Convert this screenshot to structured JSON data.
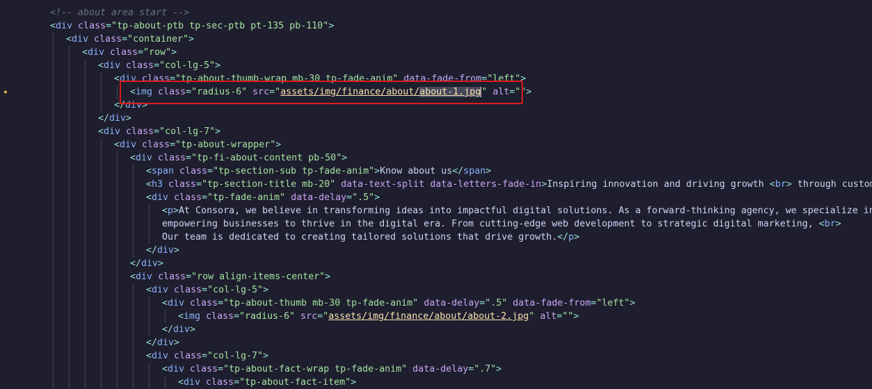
{
  "lines": [
    [
      [
        "cmt",
        "<!-- about area start -->"
      ]
    ],
    [
      [
        "brk",
        "<"
      ],
      [
        "tag",
        "div"
      ],
      [
        "attr",
        " class"
      ],
      [
        "eq",
        "="
      ],
      [
        "str",
        "\"tp-about-ptb tp-sec-ptb pt-135 pb-110\""
      ],
      [
        "brk",
        ">"
      ]
    ],
    [
      [
        "brk",
        "<"
      ],
      [
        "tag",
        "div"
      ],
      [
        "attr",
        " class"
      ],
      [
        "eq",
        "="
      ],
      [
        "str",
        "\"container\""
      ],
      [
        "brk",
        ">"
      ]
    ],
    [
      [
        "brk",
        "<"
      ],
      [
        "tag",
        "div"
      ],
      [
        "attr",
        " class"
      ],
      [
        "eq",
        "="
      ],
      [
        "str",
        "\"row\""
      ],
      [
        "brk",
        ">"
      ]
    ],
    [
      [
        "brk",
        "<"
      ],
      [
        "tag",
        "div"
      ],
      [
        "attr",
        " class"
      ],
      [
        "eq",
        "="
      ],
      [
        "str",
        "\"col-lg-5\""
      ],
      [
        "brk",
        ">"
      ]
    ],
    [
      [
        "brk",
        "<"
      ],
      [
        "tag",
        "div"
      ],
      [
        "attr",
        " class"
      ],
      [
        "eq",
        "="
      ],
      [
        "str",
        "\"tp-about-thumb-wrap mb-30 tp-fade-anim\""
      ],
      [
        "attr",
        " data-fade-from"
      ],
      [
        "eq",
        "="
      ],
      [
        "str",
        "\"left\""
      ],
      [
        "brk",
        ">"
      ]
    ],
    [
      [
        "brk",
        "<"
      ],
      [
        "tag",
        "img"
      ],
      [
        "attr",
        " class"
      ],
      [
        "eq",
        "="
      ],
      [
        "str",
        "\"radius-6\""
      ],
      [
        "attr",
        " src"
      ],
      [
        "eq",
        "="
      ],
      [
        "str",
        "\""
      ],
      [
        "link",
        "assets/img/finance/about/"
      ],
      [
        "linksel",
        "about-1.jpg"
      ],
      [
        "cursor",
        ""
      ],
      [
        "str",
        "\""
      ],
      [
        "attr",
        " alt"
      ],
      [
        "eq",
        "="
      ],
      [
        "str",
        "\"\""
      ],
      [
        "brk",
        ">"
      ]
    ],
    [
      [
        "brk",
        "</"
      ],
      [
        "tag",
        "div"
      ],
      [
        "brk",
        ">"
      ]
    ],
    [
      [
        "brk",
        "</"
      ],
      [
        "tag",
        "div"
      ],
      [
        "brk",
        ">"
      ]
    ],
    [
      [
        "brk",
        "<"
      ],
      [
        "tag",
        "div"
      ],
      [
        "attr",
        " class"
      ],
      [
        "eq",
        "="
      ],
      [
        "str",
        "\"col-lg-7\""
      ],
      [
        "brk",
        ">"
      ]
    ],
    [
      [
        "brk",
        "<"
      ],
      [
        "tag",
        "div"
      ],
      [
        "attr",
        " class"
      ],
      [
        "eq",
        "="
      ],
      [
        "str",
        "\"tp-about-wrapper\""
      ],
      [
        "brk",
        ">"
      ]
    ],
    [
      [
        "brk",
        "<"
      ],
      [
        "tag",
        "div"
      ],
      [
        "attr",
        " class"
      ],
      [
        "eq",
        "="
      ],
      [
        "str",
        "\"tp-fi-about-content pb-50\""
      ],
      [
        "brk",
        ">"
      ]
    ],
    [
      [
        "brk",
        "<"
      ],
      [
        "tag",
        "span"
      ],
      [
        "attr",
        " class"
      ],
      [
        "eq",
        "="
      ],
      [
        "str",
        "\"tp-section-sub tp-fade-anim\""
      ],
      [
        "brk",
        ">"
      ],
      [
        "txt",
        "Know about us"
      ],
      [
        "brk",
        "</"
      ],
      [
        "tag",
        "span"
      ],
      [
        "brk",
        ">"
      ]
    ],
    [
      [
        "brk",
        "<"
      ],
      [
        "tag",
        "h3"
      ],
      [
        "attr",
        " class"
      ],
      [
        "eq",
        "="
      ],
      [
        "str",
        "\"tp-section-title mb-20\""
      ],
      [
        "attr",
        " data-text-split data-letters-fade-in"
      ],
      [
        "brk",
        ">"
      ],
      [
        "txt",
        "Inspiring innovation and driving growth "
      ],
      [
        "brk",
        "<"
      ],
      [
        "tag",
        "br"
      ],
      [
        "brk",
        ">"
      ],
      [
        "txt",
        " through customized"
      ]
    ],
    [
      [
        "brk",
        "<"
      ],
      [
        "tag",
        "div"
      ],
      [
        "attr",
        " class"
      ],
      [
        "eq",
        "="
      ],
      [
        "str",
        "\"tp-fade-anim\""
      ],
      [
        "attr",
        " data-delay"
      ],
      [
        "eq",
        "="
      ],
      [
        "str",
        "\".5\""
      ],
      [
        "brk",
        ">"
      ]
    ],
    [
      [
        "brk",
        "<"
      ],
      [
        "tag",
        "p"
      ],
      [
        "brk",
        ">"
      ],
      [
        "txt",
        "At Consora, we believe in transforming ideas into impactful digital solutions. As a forward-thinking agency, we specialize in "
      ],
      [
        "brk",
        "<"
      ],
      [
        "tag",
        "br"
      ],
      [
        "brk",
        ">"
      ]
    ],
    [
      [
        "txt",
        "empowering businesses to thrive in the digital era. From cutting-edge web development to strategic digital marketing, "
      ],
      [
        "brk",
        "<"
      ],
      [
        "tag",
        "br"
      ],
      [
        "brk",
        ">"
      ]
    ],
    [
      [
        "txt",
        "Our team is dedicated to creating tailored solutions that drive growth."
      ],
      [
        "brk",
        "</"
      ],
      [
        "tag",
        "p"
      ],
      [
        "brk",
        ">"
      ]
    ],
    [
      [
        "brk",
        "</"
      ],
      [
        "tag",
        "div"
      ],
      [
        "brk",
        ">"
      ]
    ],
    [
      [
        "brk",
        "</"
      ],
      [
        "tag",
        "div"
      ],
      [
        "brk",
        ">"
      ]
    ],
    [
      [
        "brk",
        "<"
      ],
      [
        "tag",
        "div"
      ],
      [
        "attr",
        " class"
      ],
      [
        "eq",
        "="
      ],
      [
        "str",
        "\"row align-items-center\""
      ],
      [
        "brk",
        ">"
      ]
    ],
    [
      [
        "brk",
        "<"
      ],
      [
        "tag",
        "div"
      ],
      [
        "attr",
        " class"
      ],
      [
        "eq",
        "="
      ],
      [
        "str",
        "\"col-lg-5\""
      ],
      [
        "brk",
        ">"
      ]
    ],
    [
      [
        "brk",
        "<"
      ],
      [
        "tag",
        "div"
      ],
      [
        "attr",
        " class"
      ],
      [
        "eq",
        "="
      ],
      [
        "str",
        "\"tp-about-thumb mb-30 tp-fade-anim\""
      ],
      [
        "attr",
        " data-delay"
      ],
      [
        "eq",
        "="
      ],
      [
        "str",
        "\".5\""
      ],
      [
        "attr",
        " data-fade-from"
      ],
      [
        "eq",
        "="
      ],
      [
        "str",
        "\"left\""
      ],
      [
        "brk",
        ">"
      ]
    ],
    [
      [
        "brk",
        "<"
      ],
      [
        "tag",
        "img"
      ],
      [
        "attr",
        " class"
      ],
      [
        "eq",
        "="
      ],
      [
        "str",
        "\"radius-6\""
      ],
      [
        "attr",
        " src"
      ],
      [
        "eq",
        "="
      ],
      [
        "str",
        "\""
      ],
      [
        "link",
        "assets/img/finance/about/about-2.jpg"
      ],
      [
        "str",
        "\""
      ],
      [
        "attr",
        " alt"
      ],
      [
        "eq",
        "="
      ],
      [
        "str",
        "\"\""
      ],
      [
        "brk",
        ">"
      ]
    ],
    [
      [
        "brk",
        "</"
      ],
      [
        "tag",
        "div"
      ],
      [
        "brk",
        ">"
      ]
    ],
    [
      [
        "brk",
        "</"
      ],
      [
        "tag",
        "div"
      ],
      [
        "brk",
        ">"
      ]
    ],
    [
      [
        "brk",
        "<"
      ],
      [
        "tag",
        "div"
      ],
      [
        "attr",
        " class"
      ],
      [
        "eq",
        "="
      ],
      [
        "str",
        "\"col-lg-7\""
      ],
      [
        "brk",
        ">"
      ]
    ],
    [
      [
        "brk",
        "<"
      ],
      [
        "tag",
        "div"
      ],
      [
        "attr",
        " class"
      ],
      [
        "eq",
        "="
      ],
      [
        "str",
        "\"tp-about-fact-wrap tp-fade-anim\""
      ],
      [
        "attr",
        " data-delay"
      ],
      [
        "eq",
        "="
      ],
      [
        "str",
        "\".7\""
      ],
      [
        "brk",
        ">"
      ]
    ],
    [
      [
        "brk",
        "<"
      ],
      [
        "tag",
        "div"
      ],
      [
        "attr",
        " class"
      ],
      [
        "eq",
        "="
      ],
      [
        "str",
        "\"tp-about-fact-item\""
      ],
      [
        "brk",
        ">"
      ]
    ]
  ],
  "indent_levels": [
    1,
    1,
    2,
    3,
    4,
    5,
    6,
    5,
    4,
    4,
    5,
    6,
    7,
    7,
    7,
    8,
    8,
    8,
    7,
    6,
    6,
    7,
    8,
    9,
    8,
    7,
    7,
    8,
    9
  ],
  "highlight_line": 6,
  "sparkle_icon": "sparkle-icon"
}
